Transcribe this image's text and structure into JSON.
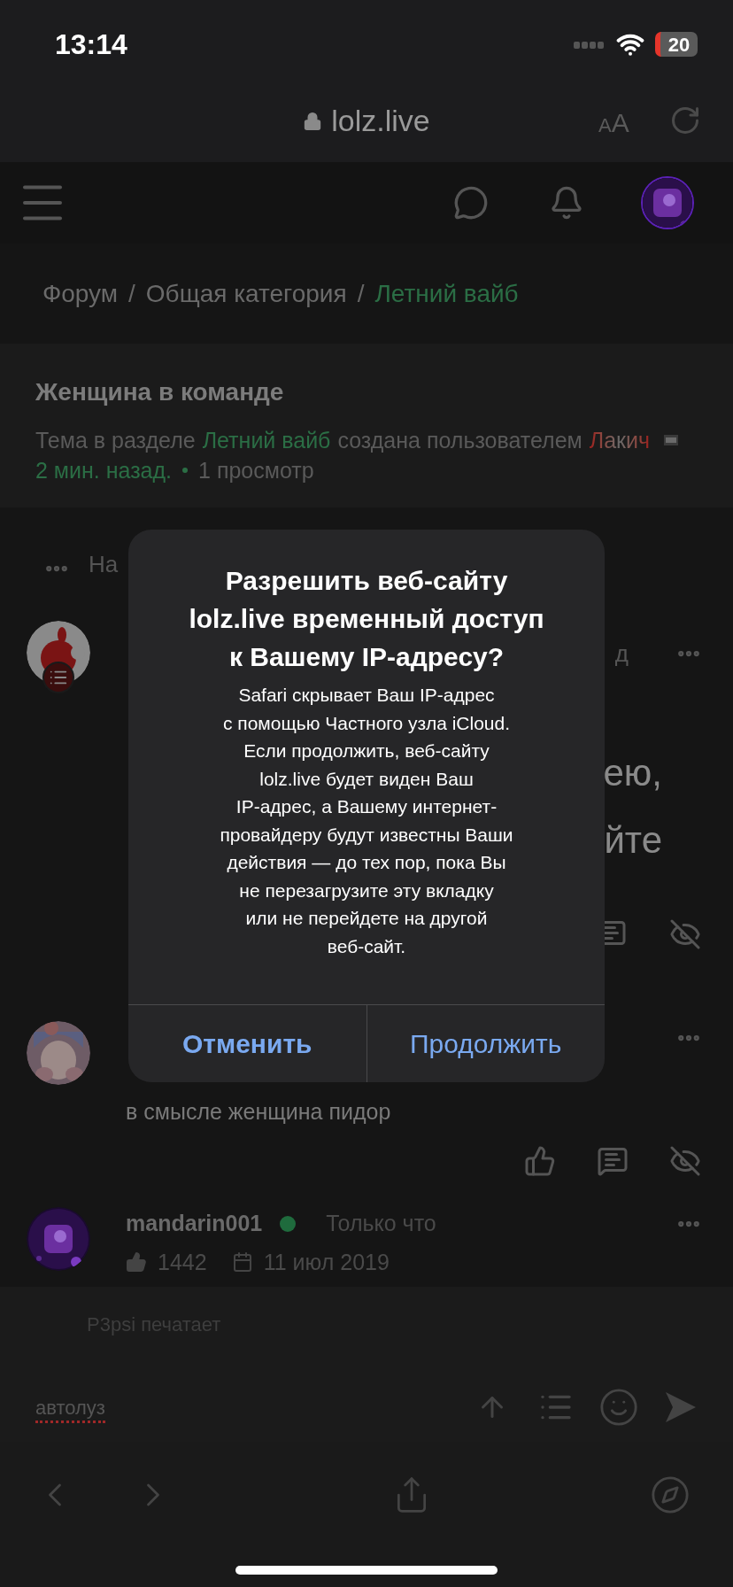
{
  "status_bar": {
    "time": "13:14",
    "battery": "20"
  },
  "address_bar": {
    "url": "lolz.live",
    "text_size_button": "AA"
  },
  "breadcrumbs": [
    {
      "label": "Форум",
      "current": false
    },
    {
      "label": "Общая категория",
      "current": false
    },
    {
      "label": "Летний вайб",
      "current": true
    }
  ],
  "breadcrumb_separator": "/",
  "thread": {
    "title": "Женщина в команде",
    "intro": "Тема в разделе",
    "section": "Летний вайб",
    "created_by": "создана пользователем",
    "author": "Лакич",
    "time": "2 мин. назад.",
    "views": "1 просмотр"
  },
  "collapsed_row": "На",
  "posts": [
    {
      "kind": "covered",
      "header_fragment": "д",
      "body_fragments": [
        "ею,",
        "йте"
      ]
    },
    {
      "kind": "reply",
      "body": "в смысле женщина пидор"
    },
    {
      "kind": "header",
      "username": "mandarin001",
      "online": true,
      "time": "Только что",
      "likes": "1442",
      "joined": "11 июл 2019"
    }
  ],
  "composer": {
    "typing": "P3psi печатает",
    "value": "автолуз",
    "misspelled": true
  },
  "dialog": {
    "title": "Разрешить веб-сайту\nlolz.live временный доступ\nк Вашему IP-адресу?",
    "body": "Safari скрывает Ваш IP-адрес\nс помощью Частного узла iCloud.\nЕсли продолжить, веб-сайту\nlolz.live будет виден Ваш\nIP-адрес, а Вашему интернет-\nпровайдеру будут известны Ваши\nдействия — до тех пор, пока Вы\nне перезагрузите эту вкладку\nили не перейдете на другой\nвеб-сайт.",
    "buttons": [
      {
        "label": "Отменить",
        "kind": "cancel"
      },
      {
        "label": "Продолжить",
        "kind": "default"
      }
    ]
  }
}
